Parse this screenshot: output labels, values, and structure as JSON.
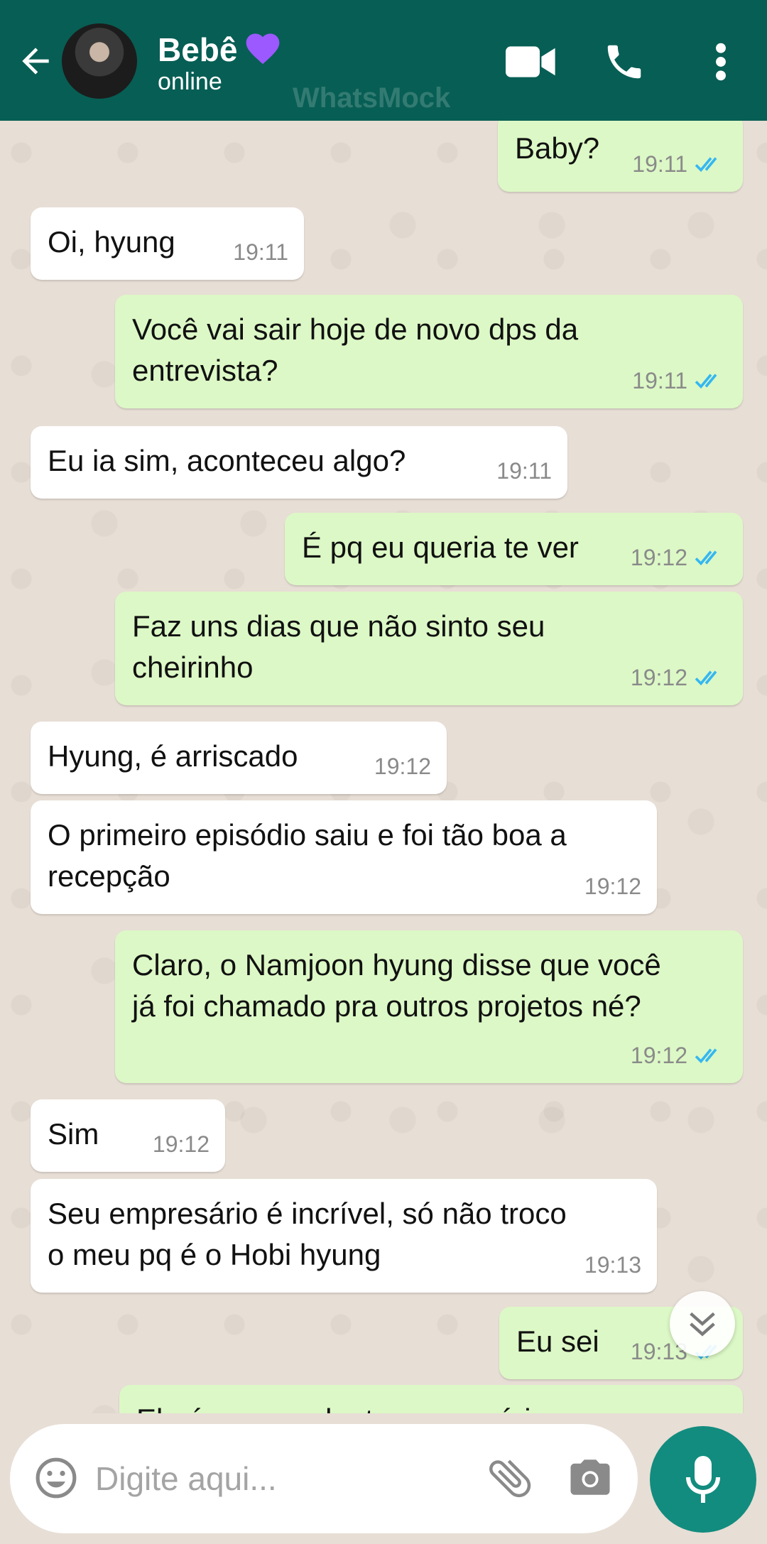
{
  "header": {
    "contact_name": "Bebê",
    "status": "online",
    "watermark": "WhatsMock",
    "heart_color": "#9b59ff",
    "icons": [
      "back-arrow-icon",
      "video-call-icon",
      "phone-icon",
      "more-vert-icon"
    ]
  },
  "messages": [
    {
      "dir": "out",
      "text": "Baby?",
      "time": "19:11",
      "read": true
    },
    {
      "dir": "in",
      "text": "Oi, hyung",
      "time": "19:11"
    },
    {
      "dir": "out",
      "text": "Você vai sair hoje de novo dps da\nentrevista?",
      "time": "19:11",
      "read": true
    },
    {
      "dir": "in",
      "text": "Eu ia sim, aconteceu algo?",
      "time": "19:11"
    },
    {
      "dir": "out",
      "text": "É pq eu queria te ver",
      "time": "19:12",
      "read": true
    },
    {
      "dir": "out",
      "text": "Faz uns dias que não sinto seu\ncheirinho",
      "time": "19:12",
      "read": true
    },
    {
      "dir": "in",
      "text": "Hyung, é arriscado",
      "time": "19:12"
    },
    {
      "dir": "in",
      "text": "O primeiro episódio saiu e foi tão boa a\nrecepção",
      "time": "19:12"
    },
    {
      "dir": "out",
      "text": "Claro, o Namjoon hyung disse que você\njá foi chamado pra outros projetos né?",
      "time": "19:12",
      "read": true
    },
    {
      "dir": "in",
      "text": "Sim",
      "time": "19:12"
    },
    {
      "dir": "in",
      "text": "Seu empresário é incrível, só não troco\no meu pq é o Hobi hyung",
      "time": "19:13"
    },
    {
      "dir": "out",
      "text": "Eu sei",
      "time": "19:13",
      "read": true
    },
    {
      "dir": "out",
      "text": "Ele é um excelente empresário",
      "time": "",
      "read": false
    }
  ],
  "composer": {
    "placeholder": "Digite aqui...",
    "icons": [
      "emoji-icon",
      "attach-icon",
      "camera-icon",
      "mic-icon"
    ]
  },
  "colors": {
    "header_bg": "#075e54",
    "outgoing_bubble": "#dcf8c6",
    "incoming_bubble": "#ffffff",
    "read_tick": "#34b7f1",
    "mic_button": "#128c7e",
    "chat_bg": "#e7ded5"
  }
}
